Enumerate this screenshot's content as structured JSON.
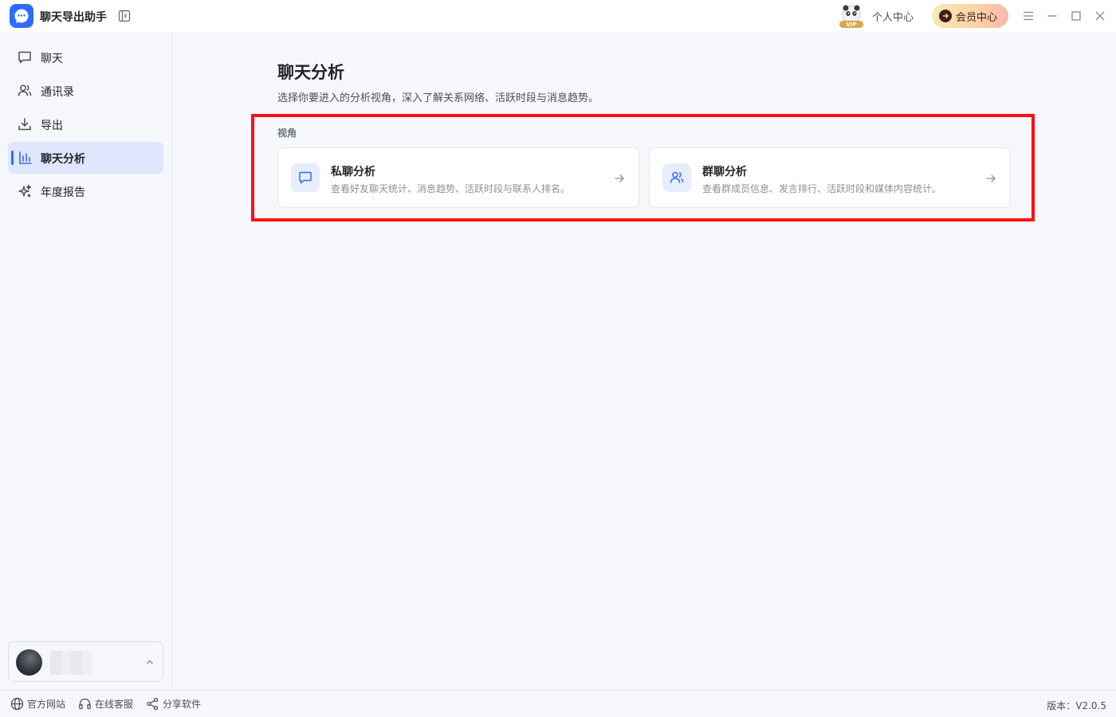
{
  "app": {
    "title": "聊天导出助手"
  },
  "header": {
    "personal_center": "个人中心",
    "member_center": "会员中心",
    "vip_badge": "VIP"
  },
  "sidebar": {
    "items": [
      {
        "label": "聊天",
        "icon": "chat-bubble-icon",
        "active": false
      },
      {
        "label": "通讯录",
        "icon": "contacts-icon",
        "active": false
      },
      {
        "label": "导出",
        "icon": "download-icon",
        "active": false
      },
      {
        "label": "聊天分析",
        "icon": "bar-chart-icon",
        "active": true
      },
      {
        "label": "年度报告",
        "icon": "sparkle-icon",
        "active": false
      }
    ]
  },
  "main": {
    "title": "聊天分析",
    "subtitle": "选择你要进入的分析视角，深入了解关系网络、活跃时段与消息趋势。",
    "section_label": "视角",
    "cards": [
      {
        "title": "私聊分析",
        "desc": "查看好友聊天统计、消息趋势、活跃时段与联系人排名。",
        "icon": "chat-bubble-icon"
      },
      {
        "title": "群聊分析",
        "desc": "查看群成员信息、发言排行、活跃时段和媒体内容统计。",
        "icon": "group-users-icon"
      }
    ]
  },
  "statusbar": {
    "links": [
      {
        "label": "官方网站",
        "icon": "globe-icon"
      },
      {
        "label": "在线客服",
        "icon": "headset-icon"
      },
      {
        "label": "分享软件",
        "icon": "share-icon"
      }
    ],
    "version": "版本：V2.0.5"
  },
  "colors": {
    "accent": "#2f6bff",
    "highlight": "#ff1010",
    "active_bg": "#dfe6fb"
  }
}
